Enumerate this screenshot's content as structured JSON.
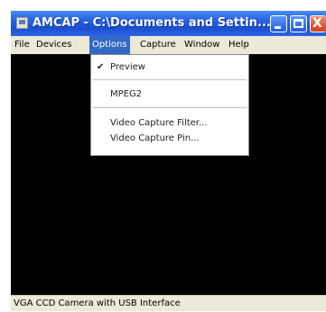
{
  "window": {
    "title": "AMCAP - C:\\Documents and Settin...",
    "icons": {
      "app": "app-icon",
      "minimize": "minimize-icon",
      "maximize": "maximize-icon",
      "close": "close-icon"
    },
    "close_glyph": "X"
  },
  "menubar": {
    "items": [
      {
        "label": "File"
      },
      {
        "label": "Devices"
      },
      {
        "label": "Options",
        "active": true
      },
      {
        "label": "Capture"
      },
      {
        "label": "Window"
      },
      {
        "label": "Help"
      }
    ]
  },
  "options_menu": {
    "items": [
      {
        "label": "Preview",
        "checked": true,
        "check_glyph": "✔"
      },
      {
        "label": "MPEG2"
      },
      {
        "label": "Video Capture Filter..."
      },
      {
        "label": "Video Capture Pin..."
      }
    ]
  },
  "statusbar": {
    "text": "VGA CCD Camera with USB Interface"
  },
  "colors": {
    "titlebar": "#2a63e0",
    "menu_highlight": "#3169c6",
    "video_background": "#000000",
    "close_button": "#d2401c"
  }
}
